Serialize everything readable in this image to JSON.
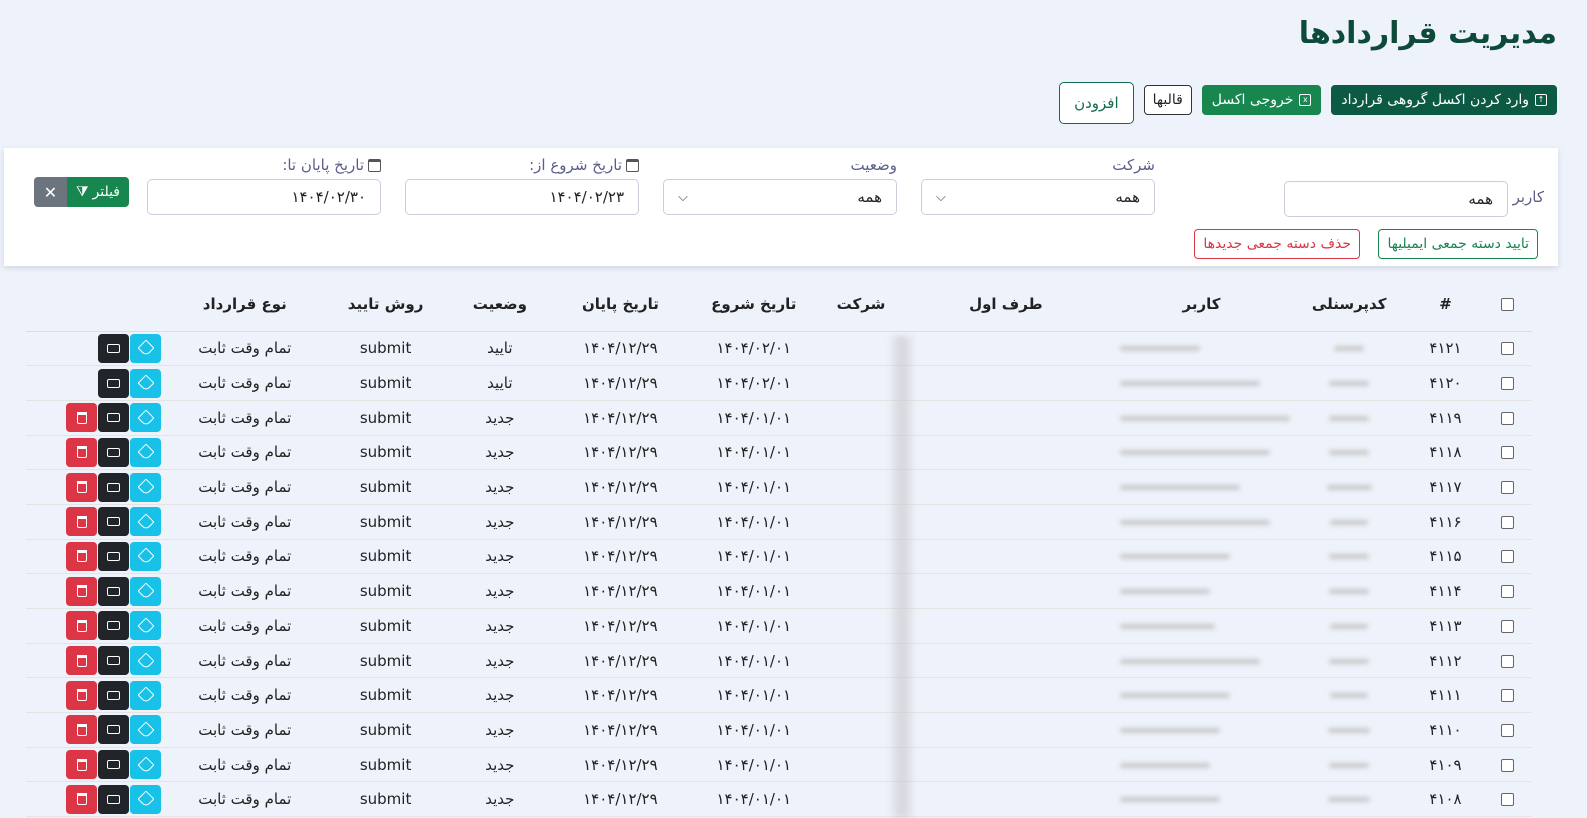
{
  "page": {
    "title": "مدیریت قراردادها"
  },
  "toolbar": {
    "add_label": "افزودن",
    "templates_label": "قالبها",
    "export_label": "خروجی اکسل",
    "import_label": "وارد کردن اکسل گروهی قرارداد"
  },
  "filters": {
    "user_label": "کاربر",
    "user_value": "همه",
    "company_label": "شرکت",
    "company_value": "همه",
    "status_label": "وضعیت",
    "status_value": "همه",
    "start_from_label": "تاریخ شروع از:",
    "start_from_value": "۱۴۰۴/۰۲/۲۳",
    "end_to_label": "تاریخ پایان تا:",
    "end_to_value": "۱۴۰۴/۰۲/۳۰",
    "filter_label": "فیلتر",
    "clear_symbol": "✕",
    "bulk_approve_label": "تایید دسته جمعی ایمیلیها",
    "bulk_delete_label": "حذف دسته جمعی جدیدها"
  },
  "table": {
    "columns": [
      "#",
      "کدپرسنلی",
      "کاربر",
      "طرف اول",
      "شرکت",
      "تاریخ شروع",
      "تاریخ پایان",
      "وضعیت",
      "روش تایید",
      "نوع قرارداد"
    ],
    "rows": [
      {
        "id": "۴۱۲۱",
        "start": "۱۴۰۴/۰۲/۰۱",
        "end": "۱۴۰۴/۱۲/۲۹",
        "status": "تایید",
        "method": "submit",
        "type": "تمام وقت ثابت",
        "deletable": false
      },
      {
        "id": "۴۱۲۰",
        "start": "۱۴۰۴/۰۲/۰۱",
        "end": "۱۴۰۴/۱۲/۲۹",
        "status": "تایید",
        "method": "submit",
        "type": "تمام وقت ثابت",
        "deletable": false
      },
      {
        "id": "۴۱۱۹",
        "start": "۱۴۰۴/۰۱/۰۱",
        "end": "۱۴۰۴/۱۲/۲۹",
        "status": "جدید",
        "method": "submit",
        "type": "تمام وقت ثابت",
        "deletable": true
      },
      {
        "id": "۴۱۱۸",
        "start": "۱۴۰۴/۰۱/۰۱",
        "end": "۱۴۰۴/۱۲/۲۹",
        "status": "جدید",
        "method": "submit",
        "type": "تمام وقت ثابت",
        "deletable": true
      },
      {
        "id": "۴۱۱۷",
        "start": "۱۴۰۴/۰۱/۰۱",
        "end": "۱۴۰۴/۱۲/۲۹",
        "status": "جدید",
        "method": "submit",
        "type": "تمام وقت ثابت",
        "deletable": true
      },
      {
        "id": "۴۱۱۶",
        "start": "۱۴۰۴/۰۱/۰۱",
        "end": "۱۴۰۴/۱۲/۲۹",
        "status": "جدید",
        "method": "submit",
        "type": "تمام وقت ثابت",
        "deletable": true
      },
      {
        "id": "۴۱۱۵",
        "start": "۱۴۰۴/۰۱/۰۱",
        "end": "۱۴۰۴/۱۲/۲۹",
        "status": "جدید",
        "method": "submit",
        "type": "تمام وقت ثابت",
        "deletable": true
      },
      {
        "id": "۴۱۱۴",
        "start": "۱۴۰۴/۰۱/۰۱",
        "end": "۱۴۰۴/۱۲/۲۹",
        "status": "جدید",
        "method": "submit",
        "type": "تمام وقت ثابت",
        "deletable": true
      },
      {
        "id": "۴۱۱۳",
        "start": "۱۴۰۴/۰۱/۰۱",
        "end": "۱۴۰۴/۱۲/۲۹",
        "status": "جدید",
        "method": "submit",
        "type": "تمام وقت ثابت",
        "deletable": true
      },
      {
        "id": "۴۱۱۲",
        "start": "۱۴۰۴/۰۱/۰۱",
        "end": "۱۴۰۴/۱۲/۲۹",
        "status": "جدید",
        "method": "submit",
        "type": "تمام وقت ثابت",
        "deletable": true
      },
      {
        "id": "۴۱۱۱",
        "start": "۱۴۰۴/۰۱/۰۱",
        "end": "۱۴۰۴/۱۲/۲۹",
        "status": "جدید",
        "method": "submit",
        "type": "تمام وقت ثابت",
        "deletable": true
      },
      {
        "id": "۴۱۱۰",
        "start": "۱۴۰۴/۰۱/۰۱",
        "end": "۱۴۰۴/۱۲/۲۹",
        "status": "جدید",
        "method": "submit",
        "type": "تمام وقت ثابت",
        "deletable": true
      },
      {
        "id": "۴۱۰۹",
        "start": "۱۴۰۴/۰۱/۰۱",
        "end": "۱۴۰۴/۱۲/۲۹",
        "status": "جدید",
        "method": "submit",
        "type": "تمام وقت ثابت",
        "deletable": true
      },
      {
        "id": "۴۱۰۸",
        "start": "۱۴۰۴/۰۱/۰۱",
        "end": "۱۴۰۴/۱۲/۲۹",
        "status": "جدید",
        "method": "submit",
        "type": "تمام وقت ثابت",
        "deletable": true
      }
    ]
  },
  "colors": {
    "brand_green": "#17874f",
    "dark_green": "#0d5a44",
    "edit": "#17c1e8",
    "print": "#212529",
    "delete": "#dc3545"
  }
}
